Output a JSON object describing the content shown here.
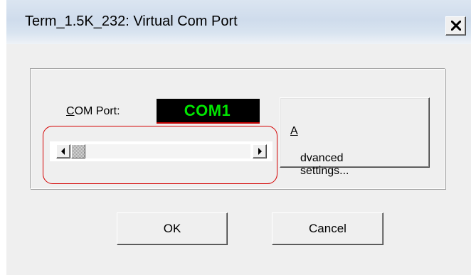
{
  "window": {
    "title": "Term_1.5K_232: Virtual Com Port",
    "close_icon": "close-icon"
  },
  "com_port": {
    "label_prefix": "C",
    "label_rest": "OM Port:",
    "value": "COM1",
    "display_color": "#00e600"
  },
  "advanced": {
    "label_prefix": "A",
    "label_rest": "dvanced settings..."
  },
  "scrollbar": {
    "position": 0.0
  },
  "buttons": {
    "ok_label": "OK",
    "cancel_label": "Cancel"
  },
  "annotation": {
    "highlight_color": "#d40000"
  }
}
